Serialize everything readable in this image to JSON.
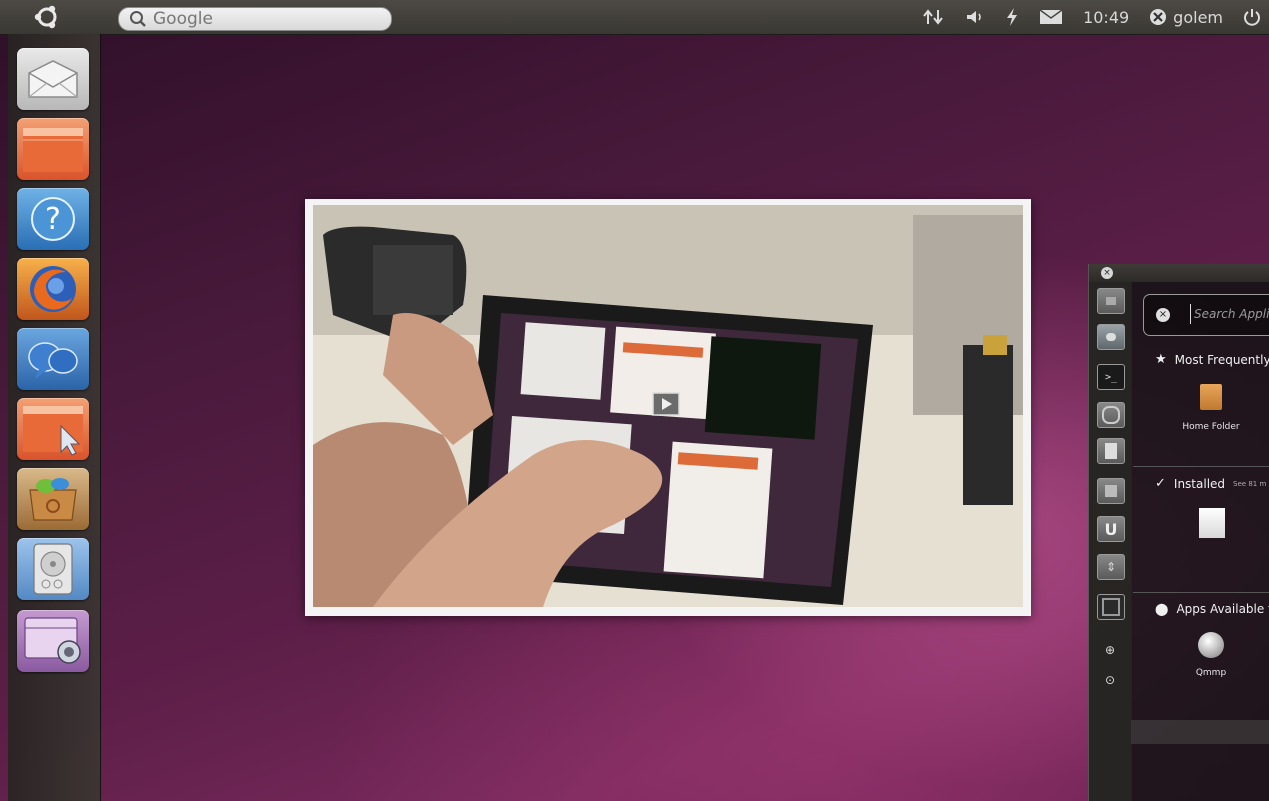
{
  "top_panel": {
    "search_placeholder": "Google",
    "time": "10:49",
    "user": "golem"
  },
  "launcher": {
    "items": [
      {
        "icon": "mail-icon"
      },
      {
        "icon": "home-folder-icon"
      },
      {
        "icon": "help-icon",
        "glyph": "?"
      },
      {
        "icon": "firefox-icon"
      },
      {
        "icon": "empathy-chat-icon"
      },
      {
        "icon": "files-folder-icon"
      },
      {
        "icon": "software-center-icon"
      },
      {
        "icon": "disk-drive-icon"
      },
      {
        "icon": "workspace-switcher-icon"
      }
    ]
  },
  "photo": {
    "description_icon": "play-icon"
  },
  "dash": {
    "search_placeholder": "Search Applic",
    "sections": {
      "most_frequent": "Most Frequently",
      "installed": "Installed",
      "installed_sub": "See 81 m",
      "apps_available": "Apps Available f"
    },
    "apps": {
      "home_folder": "Home Folder",
      "qmmp": "Qmmp"
    },
    "mini_launcher": {
      "u_glyph": "U"
    }
  }
}
